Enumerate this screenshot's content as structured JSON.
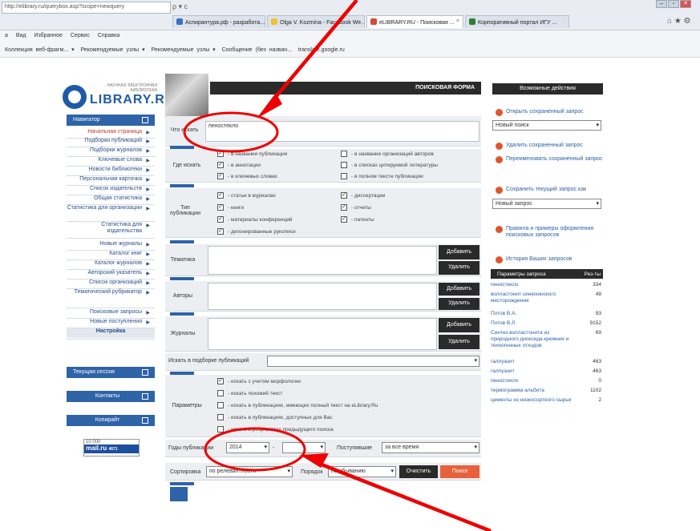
{
  "browser": {
    "url": "http://elibrary.ru/querybox.asp?scope=newquery",
    "nav_icons": "ρ ▾ c",
    "tabs": [
      {
        "label": "Аспирантура.рф - разработа...",
        "on": false,
        "color": "#3a6fc4"
      },
      {
        "label": "Olga V. Kozmina - Facebook We...",
        "on": false,
        "color": "#f1c232"
      },
      {
        "label": "eLIBRARY.RU - Поисковая ...",
        "on": true,
        "color": "#d24a3a"
      },
      {
        "label": "Корпоративный портал ИГУ ...",
        "on": false,
        "color": "#2e7d32"
      }
    ],
    "menu": "а Вид Избранное Сервис Справка",
    "favorites": [
      "Коллекция веб-фрагм... ▾",
      "Рекомендуемые узлы ▾",
      "Рекомендуемые узлы ▾",
      "Сообщение (без назван...",
      "translate.google.ru"
    ],
    "win_controls": [
      "–",
      "▫",
      "✕"
    ],
    "right_icons": "⌂ ★ ⚙"
  },
  "logo": {
    "line1": "НАУЧНАЯ ЭЛЕКТРОННАЯ",
    "line2": "БИБЛИОТЕКА",
    "brand": "LIBRARY.RU"
  },
  "left_menu": {
    "nav_header": "Навигатор",
    "items": [
      {
        "label": "Начальная страница",
        "red": true
      },
      {
        "label": "Подборки публикаций"
      },
      {
        "label": "Подборки журналов"
      },
      {
        "label": "Ключевые слова"
      },
      {
        "label": "Новости библиотеки"
      },
      {
        "label": "Персональная карточка"
      },
      {
        "label": "Список издательств"
      },
      {
        "label": "Общая статистика"
      },
      {
        "label": "Статистика для организации"
      },
      {
        "label": "Статистика для издательства"
      },
      {
        "label": "Новые журналы"
      },
      {
        "label": "Каталог книг"
      },
      {
        "label": "Каталог журналов"
      },
      {
        "label": "Авторский указатель"
      },
      {
        "label": "Список организаций"
      },
      {
        "label": "Тематический рубрикатор"
      },
      {
        "label": "Поисковые запросы"
      },
      {
        "label": "Новые поступления"
      },
      {
        "label": "Настройка",
        "bold": true
      }
    ],
    "session_header": "Текущая сессия",
    "contacts_header": "Контакты",
    "copyright_header": "Копирайт",
    "counter_top": "10 000",
    "counter_brand": "mail.ru",
    "counter_num": "4671"
  },
  "form": {
    "title": "ПОИСКОВАЯ ФОРМА",
    "what_label": "Что искать",
    "what_value": "пеностекло",
    "where_label": "Где искать",
    "where_options": [
      {
        "label": "- в названии публикации",
        "checked": true
      },
      {
        "label": "- в названии организаций авторов",
        "checked": false
      },
      {
        "label": "- в аннотации",
        "checked": true
      },
      {
        "label": "- в списках цитируемой литературы",
        "checked": false
      },
      {
        "label": "- в ключевых словах",
        "checked": true
      },
      {
        "label": "- в полном тексте публикации",
        "checked": false
      }
    ],
    "type_label": "Тип публикации",
    "type_options": [
      {
        "label": "- статьи в журналах",
        "checked": true
      },
      {
        "label": "- диссертации",
        "checked": true
      },
      {
        "label": "- книги",
        "checked": true
      },
      {
        "label": "- отчеты",
        "checked": true
      },
      {
        "label": "- материалы конференций",
        "checked": true
      },
      {
        "label": "- патенты",
        "checked": true
      },
      {
        "label": "- депонированные рукописи",
        "checked": true
      }
    ],
    "topic_label": "Тематика",
    "authors_label": "Авторы",
    "journals_label": "Журналы",
    "add_label": "Добавить",
    "delete_label": "Удалить",
    "search_in_label": "Искать в подборке публикаций",
    "params_label": "Параметры",
    "params_options": [
      {
        "label": "- искать с учетом морфологии",
        "checked": true
      },
      {
        "label": "- искать похожий текст",
        "checked": false
      },
      {
        "label": "- искать в публикациях, имеющих полный текст на eLibrary.Ru",
        "checked": false
      },
      {
        "label": "- искать в публикациях, доступных для Вас",
        "checked": false
      },
      {
        "label": "- искать в результатах предыдущего поиска",
        "checked": false
      }
    ],
    "years_label": "Годы публикации",
    "year_from": "2014",
    "year_dash": "-",
    "year_to": "",
    "received_label": "Поступившие",
    "received_value": "за все время",
    "sort_label": "Сортировка",
    "sort_value": "по релевантности",
    "order_label": "Порядок",
    "order_value": "по убыванию",
    "clear_label": "Очистить",
    "search_label": "Поиск"
  },
  "right_panel": {
    "title": "Возможные действия",
    "open_saved": "Открыть сохраненный запрос",
    "select1": "Новый поиск",
    "delete_saved": "Удалить сохраненный запрос",
    "rename_saved": "Переименовать сохраненный запрос",
    "save_current": "Сохранить текущий запрос как",
    "select2": "Новый запрос",
    "rules": "Правила и примеры оформления поисковых запросов",
    "history": "История Ваших запросов",
    "col1": "Параметры запроса",
    "col2": "Рез-ты",
    "rows": [
      {
        "q": "пеностекло",
        "n": "334"
      },
      {
        "q": "волластонит синюхинского месторождения",
        "n": "49"
      },
      {
        "q": "Потов В.А.",
        "n": "93"
      },
      {
        "q": "Потов В.Л.",
        "n": "9152"
      },
      {
        "q": "Синтез волластонита из природного диоксида кремния и техногенных отходов",
        "n": "69"
      },
      {
        "q": "галлуазит",
        "n": "463"
      },
      {
        "q": "галлуазит",
        "n": "463"
      },
      {
        "q": "пеностекло",
        "n": "0"
      },
      {
        "q": "термограмма альбита",
        "n": "1102"
      },
      {
        "q": "цементы из низкосортного сырья",
        "n": "2"
      }
    ]
  }
}
